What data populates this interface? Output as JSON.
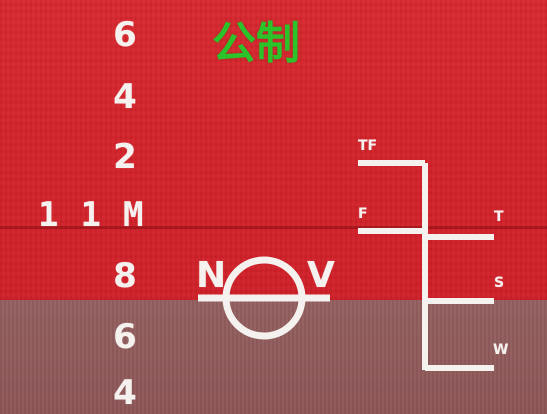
{
  "caption": "公制",
  "draft_scale": [
    {
      "label": "6"
    },
    {
      "label": "4"
    },
    {
      "label": "2"
    },
    {
      "label": "11M"
    },
    {
      "label": "8"
    },
    {
      "label": "6"
    },
    {
      "label": "4"
    }
  ],
  "plimsoll": {
    "left_letter": "N",
    "right_letter": "V"
  },
  "load_lines": {
    "tropical_fresh": "TF",
    "fresh": "F",
    "tropical": "T",
    "summer": "S",
    "winter": "W"
  },
  "colors": {
    "hull_red": "#d3222a",
    "antifouling": "#8e5758",
    "paint": "#f4f1ee",
    "caption": "#2cc32a"
  }
}
